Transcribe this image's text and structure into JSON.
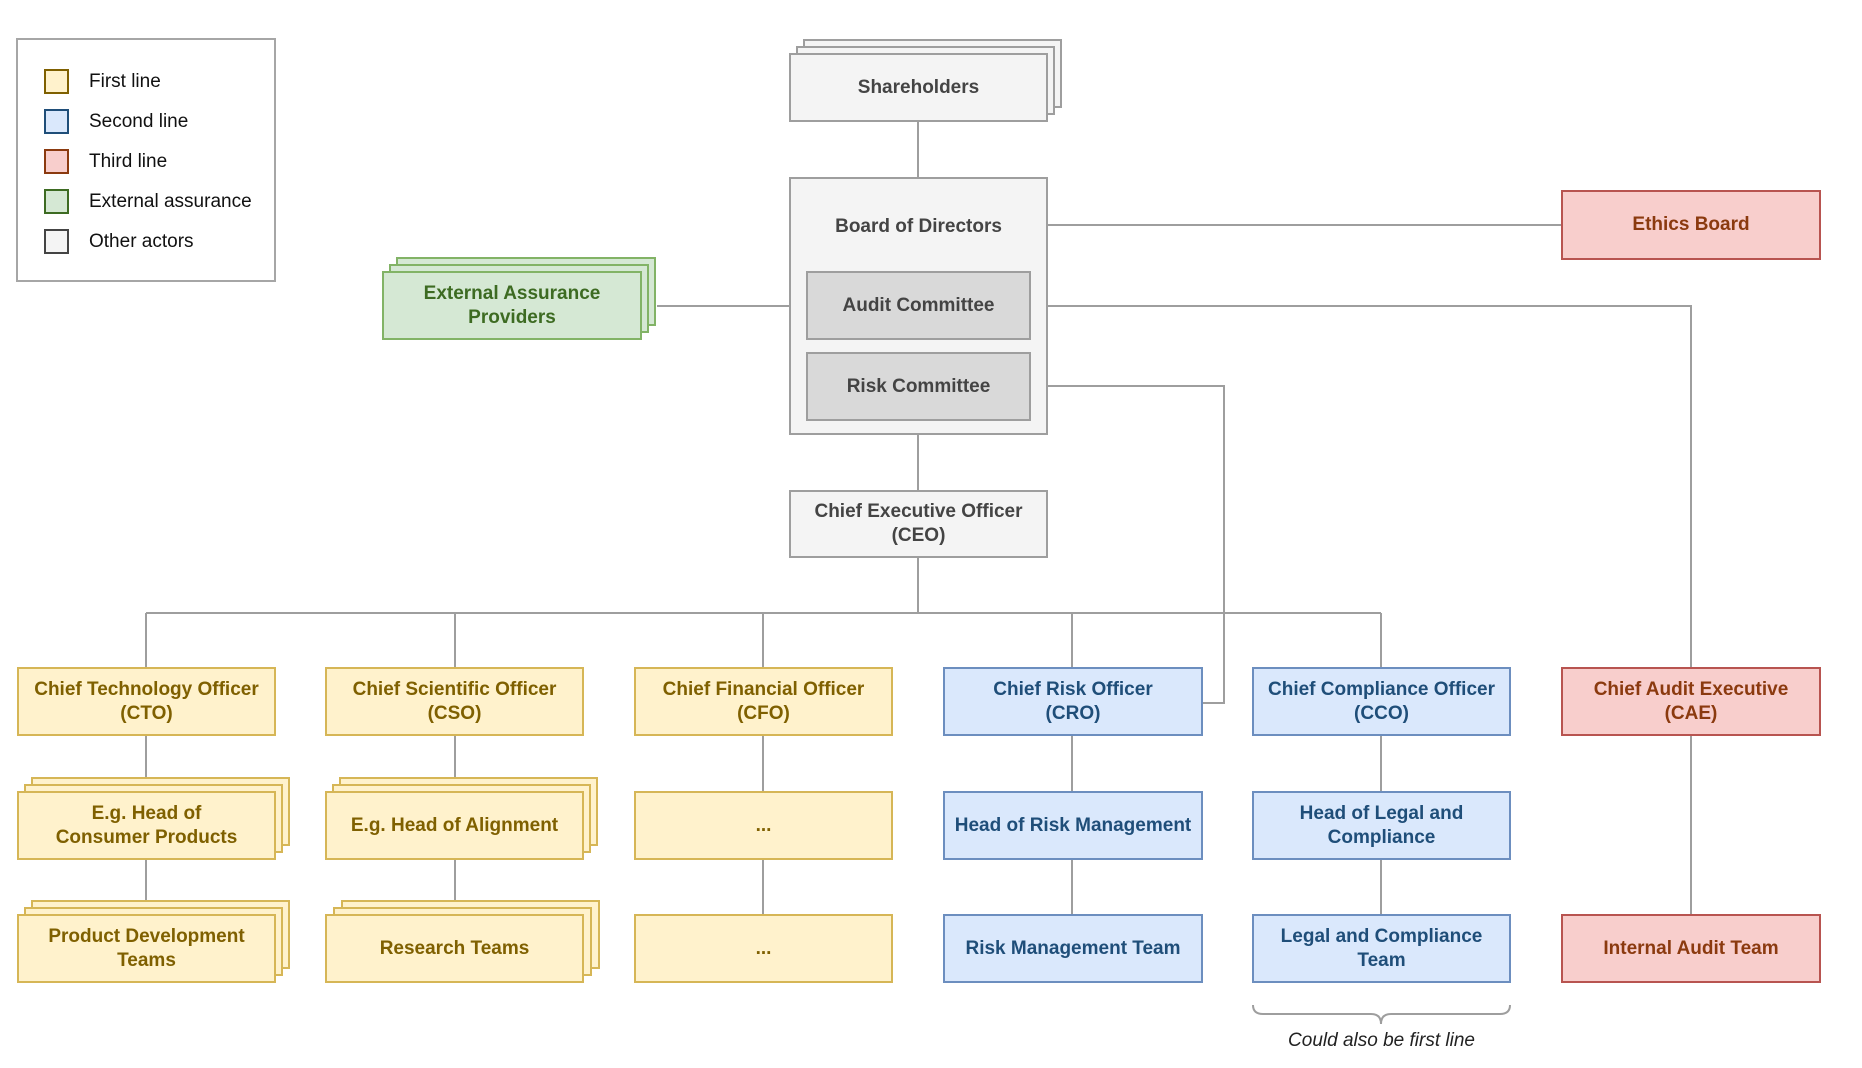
{
  "legend": {
    "items": [
      {
        "label": "First line",
        "color": "#fff2cc"
      },
      {
        "label": "Second line",
        "color": "#dae8fc"
      },
      {
        "label": "Third line",
        "color": "#f8cecc"
      },
      {
        "label": "External assurance",
        "color": "#d5e8d4"
      },
      {
        "label": "Other actors",
        "color": "#f4f4f4"
      }
    ]
  },
  "governance": {
    "shareholders": "Shareholders",
    "board": "Board of Directors",
    "audit_committee": "Audit Committee",
    "risk_committee": "Risk Committee",
    "external_assurance": "External Assurance\nProviders",
    "ethics_board": "Ethics Board",
    "ceo": "Chief Executive Officer\n(CEO)"
  },
  "columns": [
    {
      "head": "Chief Technology Officer\n(CTO)",
      "mid": "E.g. Head of\nConsumer Products",
      "team": "Product Development\nTeams",
      "line": "first"
    },
    {
      "head": "Chief Scientific Officer\n(CSO)",
      "mid": "E.g. Head of Alignment",
      "team": "Research Teams",
      "line": "first"
    },
    {
      "head": "Chief Financial Officer\n(CFO)",
      "mid": "...",
      "team": "...",
      "line": "first"
    },
    {
      "head": "Chief Risk Officer\n(CRO)",
      "mid": "Head of Risk Management",
      "team": "Risk Management Team",
      "line": "second"
    },
    {
      "head": "Chief Compliance Officer\n(CCO)",
      "mid": "Head of Legal and\nCompliance",
      "team": "Legal and Compliance\nTeam",
      "line": "second"
    },
    {
      "head": "Chief Audit Executive\n(CAE)",
      "mid": "",
      "team": "Internal Audit Team",
      "line": "third"
    }
  ],
  "annotation": "Could also be first line",
  "colors": {
    "first_line": "#fff2cc",
    "second_line": "#dae8fc",
    "third_line": "#f8cecc",
    "external": "#d5e8d4",
    "other": "#f4f4f4",
    "connector": "#9e9e9e"
  }
}
